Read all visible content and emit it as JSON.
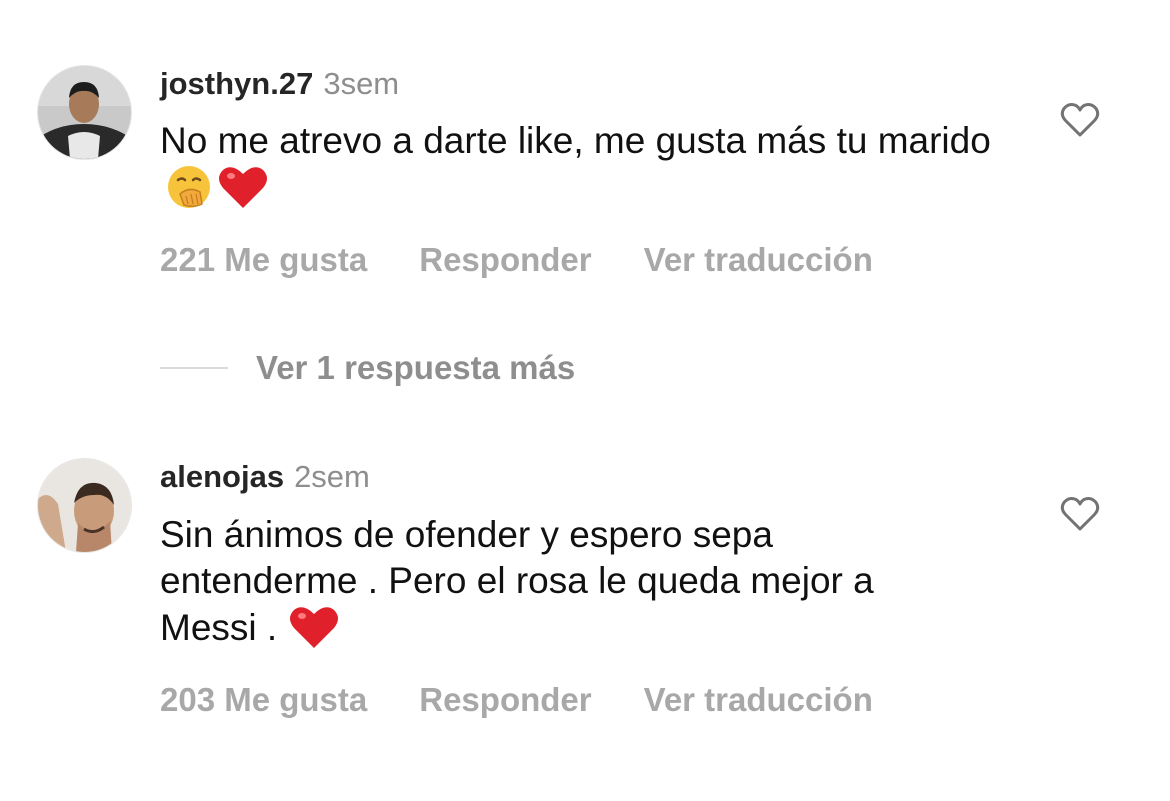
{
  "comments": [
    {
      "username": "josthyn.27",
      "time": "3sem",
      "text": "No me atrevo a darte like, me gusta más tu marido",
      "emojis": [
        "hand-over-mouth-emoji",
        "red-heart-emoji"
      ],
      "likes": "221 Me gusta",
      "reply_label": "Responder",
      "translate_label": "Ver traducción"
    },
    {
      "username": "alenojas",
      "time": "2sem",
      "text_lines": [
        "Sin ánimos de ofender y espero sepa",
        "entenderme . Pero el rosa le queda mejor a",
        "Messi ."
      ],
      "emojis": [
        "red-heart-emoji"
      ],
      "likes": "203 Me gusta",
      "reply_label": "Responder",
      "translate_label": "Ver traducción"
    }
  ],
  "view_replies": "Ver 1 respuesta más",
  "icons": {
    "like": "heart-outline-icon"
  },
  "colors": {
    "text": "#111111",
    "secondary": "#8e8e8e",
    "actions": "#a8a8a8",
    "heart": "#e0202a"
  }
}
